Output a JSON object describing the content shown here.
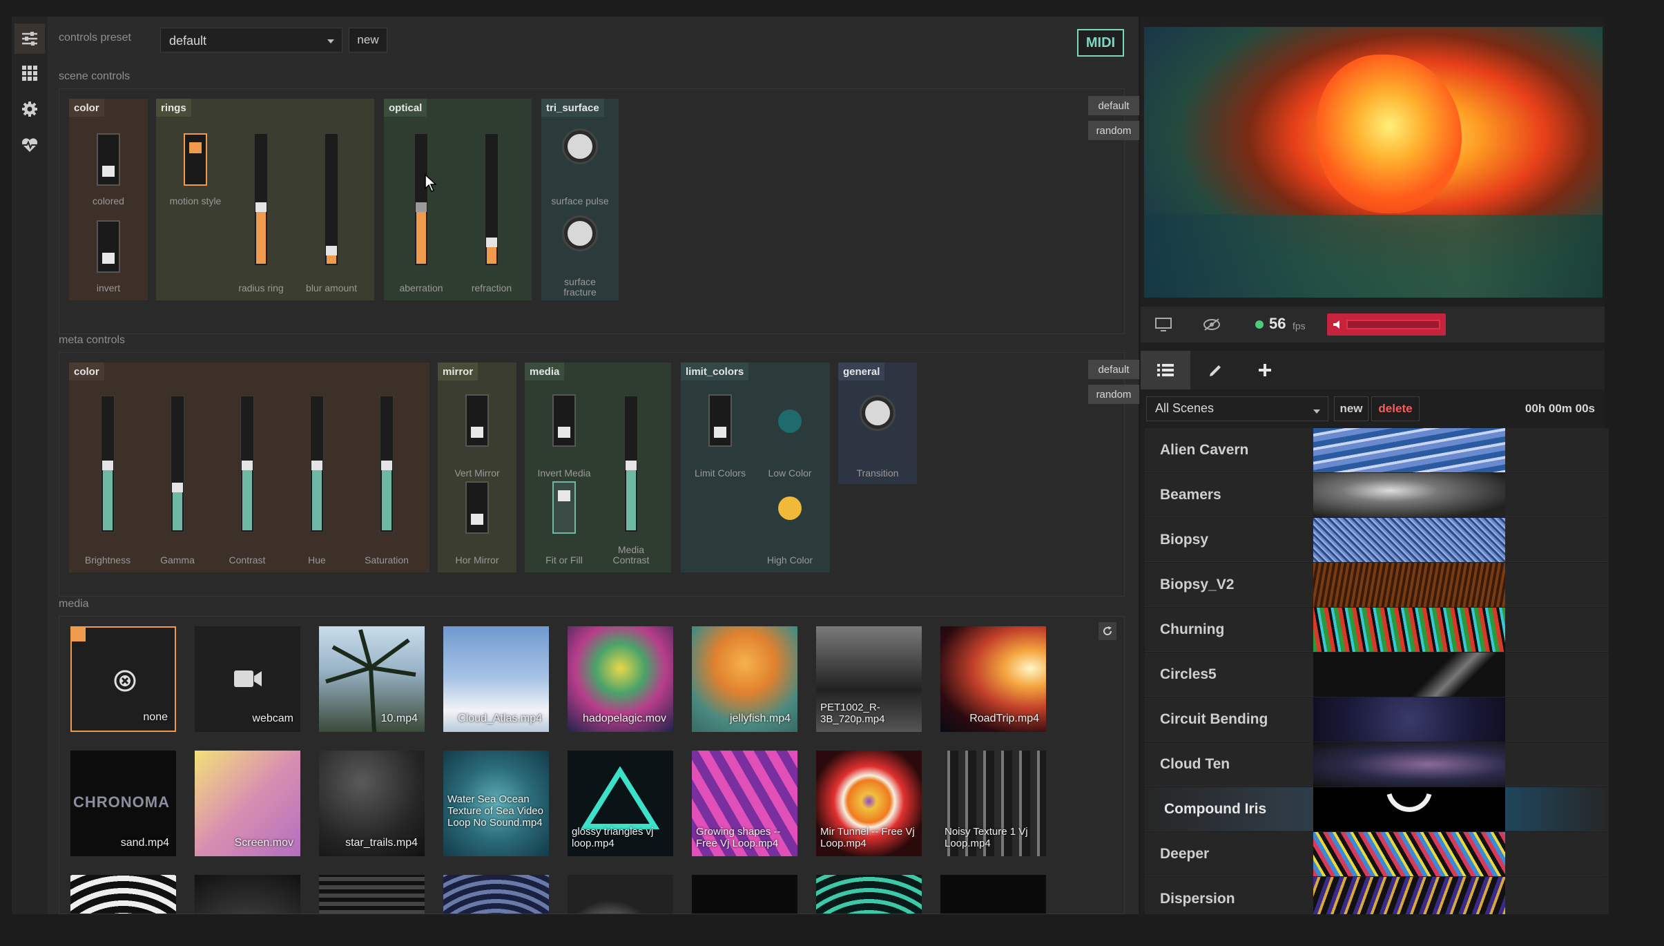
{
  "colors": {
    "accent_orange": "#f09a4e",
    "teal": "#6fb8a4",
    "midi": "#7fd7c1",
    "delete": "#ff5a5a",
    "fps_green": "#4cc97a",
    "volume_red": "#c8233c"
  },
  "top": {
    "preset_label": "controls preset",
    "preset_value": "default",
    "new_label": "new",
    "midi_label": "MIDI"
  },
  "scene_controls": {
    "title": "scene controls",
    "default_label": "default",
    "random_label": "random",
    "groups": {
      "color": "color",
      "rings": "rings",
      "optical": "optical",
      "tri_surface": "tri_surface"
    },
    "labels": {
      "colored": "colored",
      "invert": "invert",
      "motion_style": "motion style",
      "radius_ring": "radius ring",
      "blur_amount": "blur amount",
      "aberration": "aberration",
      "refraction": "refraction",
      "surface_pulse": "surface pulse",
      "surface_fracture": "surface fracture"
    },
    "values": {
      "colored": 0.15,
      "invert": 0.15,
      "motion_style": 0.85,
      "radius_ring": 0.45,
      "blur_amount": 0.08,
      "aberration": 0.45,
      "refraction": 0.15
    }
  },
  "meta_controls": {
    "title": "meta controls",
    "default_label": "default",
    "random_label": "random",
    "groups": {
      "color": "color",
      "mirror": "mirror",
      "media": "media",
      "limit_colors": "limit_colors",
      "general": "general"
    },
    "labels": {
      "brightness": "Brightness",
      "gamma": "Gamma",
      "contrast": "Contrast",
      "hue": "Hue",
      "saturation": "Saturation",
      "vert_mirror": "Vert Mirror",
      "hor_mirror": "Hor Mirror",
      "invert_media": "Invert Media",
      "fit_or_fill": "Fit or Fill",
      "media_contrast": "Media Contrast",
      "limit_colors": "Limit Colors",
      "low_color": "Low Color",
      "high_color": "High Color",
      "transition": "Transition"
    },
    "values": {
      "brightness": 0.5,
      "gamma": 0.32,
      "contrast": 0.5,
      "hue": 0.5,
      "saturation": 0.5,
      "media_contrast": 0.5,
      "vert_mirror": 0.15,
      "hor_mirror": 0.15,
      "invert_media": 0.15,
      "fit_or_fill": 0.85,
      "limit_colors": 0.15
    }
  },
  "media": {
    "title": "media",
    "items": [
      "none",
      "webcam",
      "10.mp4",
      "Cloud_Atlas.mp4",
      "hadopelagic.mov",
      "jellyfish.mp4",
      "PET1002_R-3B_720p.mp4",
      "RoadTrip.mp4",
      "sand.mp4",
      "Screen.mov",
      "star_trails.mp4",
      "Water Sea Ocean Texture of Sea Video Loop No Sound.mp4",
      "glossy triangles vj loop.mp4",
      "Growing shapes -- Free Vj Loop.mp4",
      "Mir Tunnel -- Free Vj Loop.mp4",
      "Noisy Texture 1 Vj Loop.mp4"
    ],
    "tile_text": {
      "sand_overlay": "CHRONOMA"
    }
  },
  "player": {
    "fps_value": "56",
    "fps_unit": "fps",
    "volume": 0.0
  },
  "scenes": {
    "filter": "All Scenes",
    "new_label": "new",
    "delete_label": "delete",
    "time": "00h 00m 00s",
    "list": [
      "Alien Cavern",
      "Beamers",
      "Biopsy",
      "Biopsy_V2",
      "Churning",
      "Circles5",
      "Circuit Bending",
      "Cloud Ten",
      "Compound Iris",
      "Deeper",
      "Dispersion"
    ],
    "selected": "Compound Iris"
  },
  "icons": [
    "sliders-icon",
    "grid-icon",
    "gear-icon",
    "heart-pulse-icon",
    "monitor-icon",
    "eye-off-icon",
    "speaker-icon",
    "list-icon",
    "pencil-icon",
    "plus-icon",
    "refresh-icon",
    "camera-icon",
    "close-circle-icon",
    "chevron-down-icon"
  ]
}
